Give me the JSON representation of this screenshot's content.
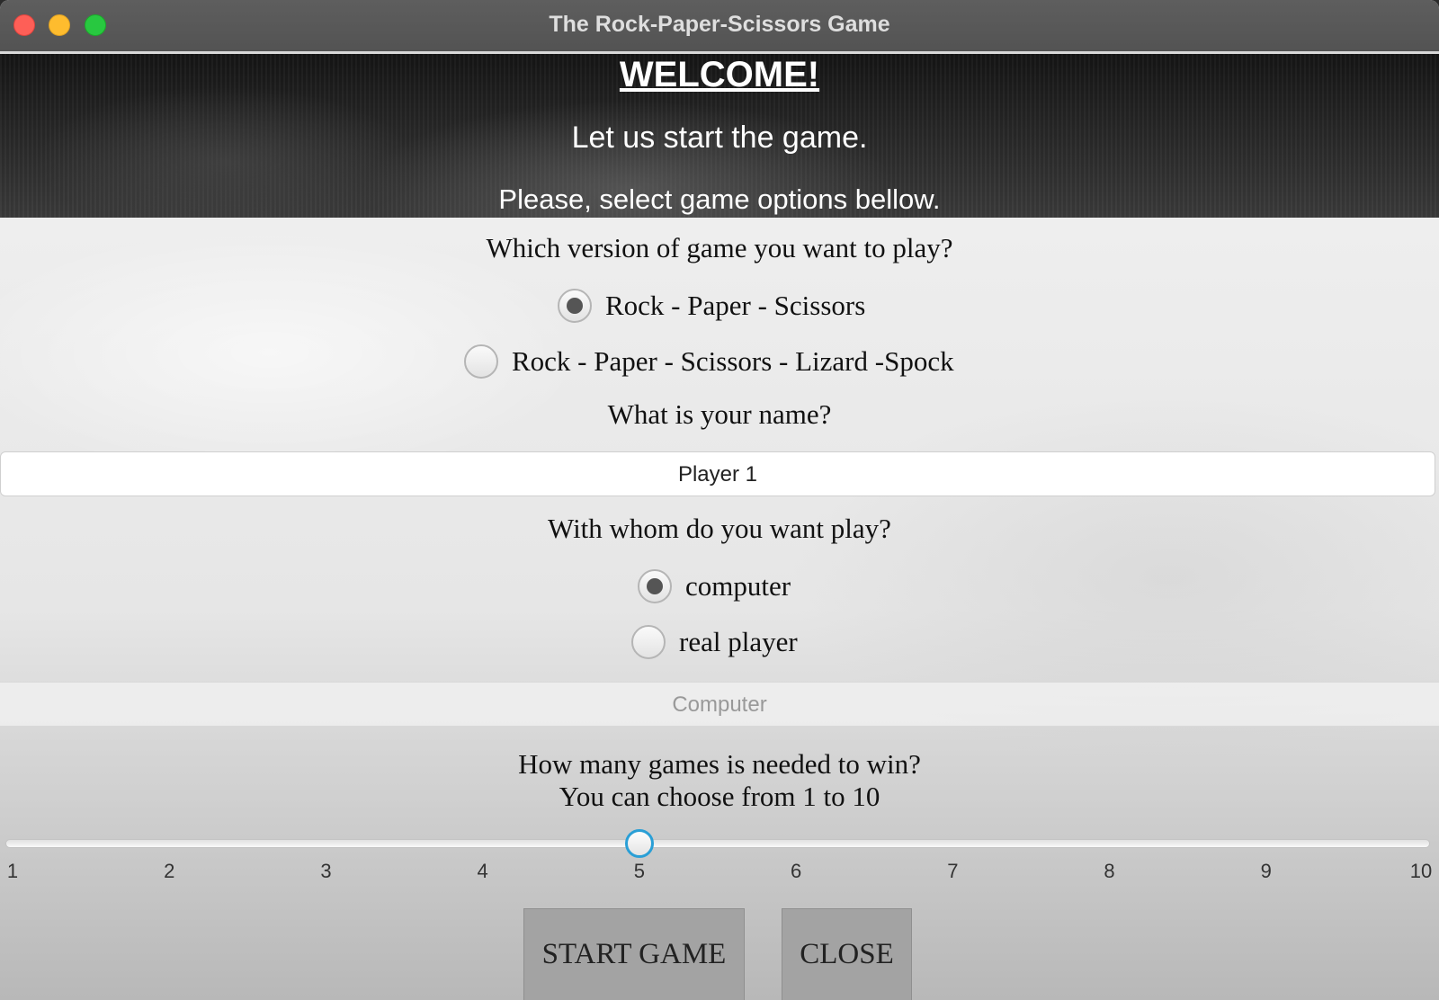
{
  "window": {
    "title": "The Rock-Paper-Scissors Game"
  },
  "header": {
    "welcome": "WELCOME!",
    "line1": "Let us start the game.",
    "line2": "Please, select game options bellow."
  },
  "version": {
    "question": "Which version of game you want to play?",
    "options": [
      {
        "label": "Rock - Paper - Scissors",
        "selected": true
      },
      {
        "label": "Rock - Paper - Scissors - Lizard -Spock",
        "selected": false
      }
    ]
  },
  "name": {
    "question": "What is your name?",
    "value": "Player 1"
  },
  "opponent": {
    "question": "With whom do you want play?",
    "options": [
      {
        "label": "computer",
        "selected": true
      },
      {
        "label": "real player",
        "selected": false
      }
    ],
    "field_value": "Computer"
  },
  "wins": {
    "question_line1": "How many games is needed to win?",
    "question_line2": "You can choose from 1 to 10",
    "min": 1,
    "max": 10,
    "value": 5,
    "ticks": [
      "1",
      "2",
      "3",
      "4",
      "5",
      "6",
      "7",
      "8",
      "9",
      "10"
    ]
  },
  "buttons": {
    "start": "START GAME",
    "close": "CLOSE"
  },
  "colors": {
    "slider_thumb_accent": "#2a9fd6",
    "button_bg": "#a3a3a3"
  }
}
